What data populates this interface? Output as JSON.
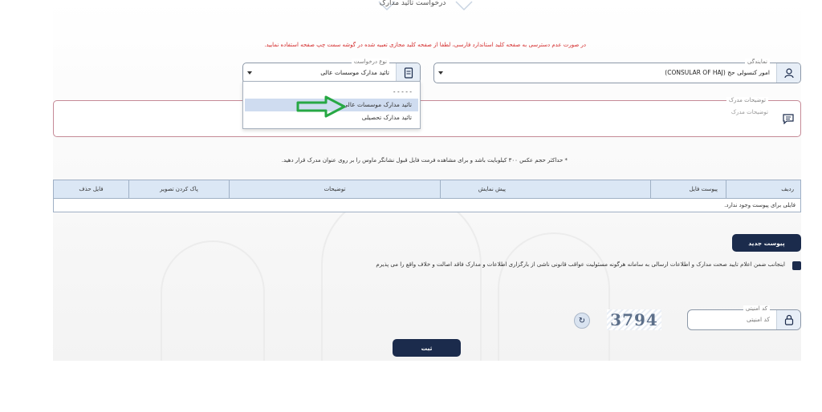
{
  "header": {
    "page_title": "درخواست تائید مدارک"
  },
  "notice": "در صورت عدم دسترسی به صفحه کلید استاندارد فارسی، لطفا از صفحه کلید مجازی تعبیه شده در گوشه سمت چپ صفحه استفاده نمایید.",
  "form": {
    "representative": {
      "label": "نمایندگی",
      "value": "امور کنسولی حج (CONSULAR OF HAJ)"
    },
    "request_type": {
      "label": "نوع درخواست",
      "value": "تائید مدارک موسسات عالی",
      "options": [
        "- - - - -",
        "تائید مدارک موسسات عالی",
        "تائید مدارک تحصیلی"
      ],
      "selected_index": 1
    },
    "description": {
      "label": "توضیحات مدرک",
      "placeholder": "توضیحات مدرک"
    },
    "size_note": "* حداکثر حجم عکس ۳۰۰ کیلوبایت باشد و برای مشاهده فرمت فایل قبول نشانگر ماوس را بر روی عنوان مدرک قرار دهید."
  },
  "table": {
    "columns": [
      "ردیف",
      "پیوست فایل",
      "پیش نمایش",
      "توضیحات",
      "پاک کردن تصویر",
      "فایل حذف"
    ],
    "empty_message": "فایلی برای پیوست وجود ندارد."
  },
  "actions": {
    "new_attachment": "پیوست جدید",
    "submit": "ثبت"
  },
  "agreement": {
    "text": "اینجانب ضمن اعلام تایید صحت مدارک و اطلاعات ارسالی به سامانه هرگونه مسئولیت عواقب قانونی ناشی از بارگزاری اطلاعات و مدارک فاقد اصالت و خلاف واقع را می پذیرم",
    "checked": true
  },
  "captcha": {
    "label": "کد امنیتی",
    "placeholder": "کد امنیتی",
    "image_text": "3794"
  },
  "colors": {
    "primary": "#1b2b4c",
    "notice_red": "#d42b2b",
    "table_header": "#dbe7f5",
    "selected_option": "#cfdcf0",
    "arrow_green": "#27a844"
  },
  "icons": {
    "representative": "user-icon",
    "request_type": "document-icon",
    "description": "chat-icon",
    "captcha": "lock-icon",
    "refresh": "refresh-icon",
    "annotation": "arrow-right-icon"
  }
}
